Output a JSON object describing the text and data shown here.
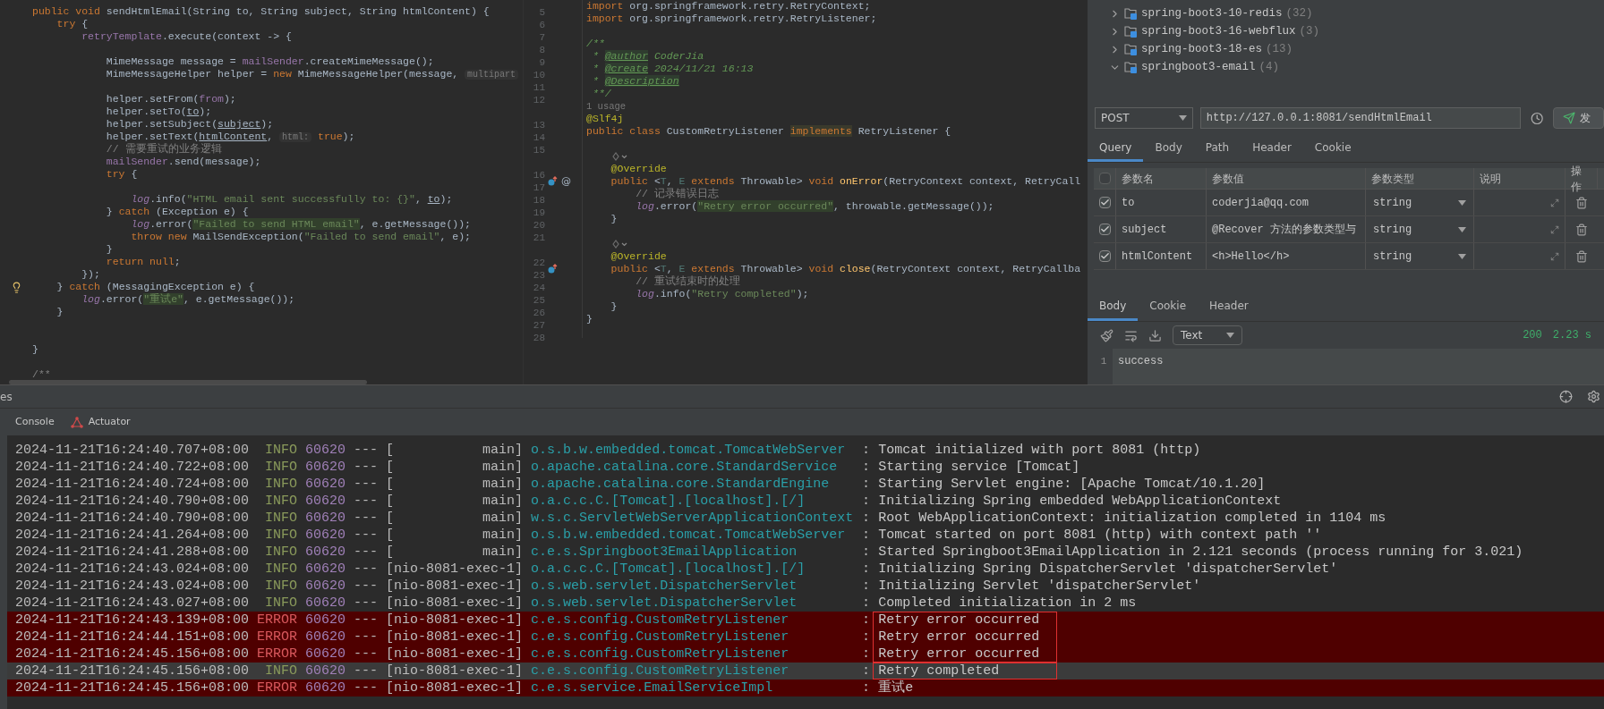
{
  "left_editor": {
    "lines": [
      {
        "kind": "code",
        "segments": [
          {
            "kind": "keyword",
            "text": "public void "
          },
          {
            "kind": "plain",
            "text": "sendHtmlEmail(String to, String subject, String htmlContent) {"
          }
        ]
      },
      {
        "kind": "code",
        "segments": [
          {
            "kind": "keyword",
            "text": "    try"
          },
          {
            "kind": "plain",
            "text": " {"
          }
        ]
      },
      {
        "kind": "code",
        "segments": [
          {
            "kind": "field",
            "text": "        retryTemplate"
          },
          {
            "kind": "plain",
            "text": ".execute(context -> {"
          }
        ]
      },
      {
        "kind": "blank"
      },
      {
        "kind": "code",
        "segments": [
          {
            "kind": "plain",
            "text": "            MimeMessage message = "
          },
          {
            "kind": "field",
            "text": "mailSender"
          },
          {
            "kind": "plain",
            "text": ".createMimeMessage();"
          }
        ]
      },
      {
        "kind": "code",
        "segments": [
          {
            "kind": "plain",
            "text": "            MimeMessageHelper helper = "
          },
          {
            "kind": "keyword",
            "text": "new "
          },
          {
            "kind": "plain",
            "text": "MimeMessageHelper(message, "
          },
          {
            "kind": "hint",
            "text": "multipart"
          }
        ]
      },
      {
        "kind": "blank"
      },
      {
        "kind": "code",
        "segments": [
          {
            "kind": "plain",
            "text": "            helper.setFrom("
          },
          {
            "kind": "field",
            "text": "from"
          },
          {
            "kind": "plain",
            "text": ");"
          }
        ]
      },
      {
        "kind": "code",
        "segments": [
          {
            "kind": "plain",
            "text": "            helper.setTo("
          },
          {
            "kind": "param",
            "text": "to"
          },
          {
            "kind": "plain",
            "text": ");"
          }
        ]
      },
      {
        "kind": "code",
        "segments": [
          {
            "kind": "plain",
            "text": "            helper.setSubject("
          },
          {
            "kind": "param",
            "text": "subject"
          },
          {
            "kind": "plain",
            "text": ");"
          }
        ]
      },
      {
        "kind": "code",
        "segments": [
          {
            "kind": "plain",
            "text": "            helper.setText("
          },
          {
            "kind": "param",
            "text": "htmlContent"
          },
          {
            "kind": "plain",
            "text": ", "
          },
          {
            "kind": "hint",
            "text": "html:"
          },
          {
            "kind": "keyword",
            "text": " true"
          },
          {
            "kind": "plain",
            "text": ");"
          }
        ]
      },
      {
        "kind": "code",
        "segments": [
          {
            "kind": "comment",
            "text": "            // 需要重试的业务逻辑"
          }
        ]
      },
      {
        "kind": "code",
        "segments": [
          {
            "kind": "field",
            "text": "            mailSender"
          },
          {
            "kind": "plain",
            "text": ".send(message);"
          }
        ]
      },
      {
        "kind": "code",
        "segments": [
          {
            "kind": "keyword",
            "text": "            try"
          },
          {
            "kind": "plain",
            "text": " {"
          }
        ]
      },
      {
        "kind": "blank"
      },
      {
        "kind": "code",
        "segments": [
          {
            "kind": "static",
            "text": "                log"
          },
          {
            "kind": "plain",
            "text": ".info("
          },
          {
            "kind": "string",
            "text": "\"HTML email sent successfully to: {}\""
          },
          {
            "kind": "plain",
            "text": ", "
          },
          {
            "kind": "param",
            "text": "to"
          },
          {
            "kind": "plain",
            "text": ");"
          }
        ]
      },
      {
        "kind": "code",
        "segments": [
          {
            "kind": "plain",
            "text": "            } "
          },
          {
            "kind": "keyword",
            "text": "catch"
          },
          {
            "kind": "plain",
            "text": " (Exception e) {"
          }
        ]
      },
      {
        "kind": "code",
        "segments": [
          {
            "kind": "static",
            "text": "                log"
          },
          {
            "kind": "plain",
            "text": ".error("
          },
          {
            "kind": "strhl",
            "text": "\"Failed to send HTML email\""
          },
          {
            "kind": "plain",
            "text": ", e.getMessage());"
          }
        ]
      },
      {
        "kind": "code",
        "segments": [
          {
            "kind": "keyword",
            "text": "                throw new "
          },
          {
            "kind": "plain",
            "text": "MailSendException("
          },
          {
            "kind": "string",
            "text": "\"Failed to send email\""
          },
          {
            "kind": "plain",
            "text": ", e);"
          }
        ]
      },
      {
        "kind": "code",
        "segments": [
          {
            "kind": "plain",
            "text": "            }"
          }
        ]
      },
      {
        "kind": "code",
        "segments": [
          {
            "kind": "keyword",
            "text": "            return null"
          },
          {
            "kind": "plain",
            "text": ";"
          }
        ]
      },
      {
        "kind": "code",
        "segments": [
          {
            "kind": "plain",
            "text": "        });"
          }
        ]
      },
      {
        "kind": "code",
        "bulb": true,
        "segments": [
          {
            "kind": "plain",
            "text": "    } "
          },
          {
            "kind": "keyword",
            "text": "catch"
          },
          {
            "kind": "plain",
            "text": " (MessagingException e) {"
          }
        ]
      },
      {
        "kind": "code",
        "segments": [
          {
            "kind": "static",
            "text": "        log"
          },
          {
            "kind": "plain",
            "text": ".error("
          },
          {
            "kind": "strhl",
            "text": "\"重试e\""
          },
          {
            "kind": "plain",
            "text": ", e.getMessage());"
          }
        ]
      },
      {
        "kind": "code",
        "segments": [
          {
            "kind": "plain",
            "text": "    }"
          }
        ]
      },
      {
        "kind": "blank"
      },
      {
        "kind": "blank"
      },
      {
        "kind": "code",
        "segments": [
          {
            "kind": "plain",
            "text": "}"
          }
        ]
      },
      {
        "kind": "blank"
      },
      {
        "kind": "code",
        "segments": [
          {
            "kind": "comment",
            "text": "/**"
          }
        ]
      }
    ]
  },
  "middle_editor": {
    "lines": [
      {
        "kind": "code",
        "number": "5",
        "segments": [
          {
            "kind": "keyword",
            "text": "import "
          },
          {
            "kind": "plain",
            "text": "org.springframework.retry.RetryContext;"
          }
        ]
      },
      {
        "kind": "code",
        "number": "6",
        "segments": [
          {
            "kind": "keyword",
            "text": "import "
          },
          {
            "kind": "plain",
            "text": "org.springframework.retry.RetryListener;"
          }
        ]
      },
      {
        "kind": "blank",
        "number": "7"
      },
      {
        "kind": "code",
        "number": "8",
        "segments": [
          {
            "kind": "doc",
            "text": "/**"
          }
        ]
      },
      {
        "kind": "code",
        "number": "9",
        "segments": [
          {
            "kind": "doc",
            "text": " * "
          },
          {
            "kind": "doctag",
            "text": "@author"
          },
          {
            "kind": "doc",
            "text": " CoderJia"
          }
        ]
      },
      {
        "kind": "code",
        "number": "10",
        "segments": [
          {
            "kind": "doc",
            "text": " * "
          },
          {
            "kind": "doctag",
            "text": "@create"
          },
          {
            "kind": "doc",
            "text": " 2024/11/21 16:13"
          }
        ]
      },
      {
        "kind": "code",
        "number": "11",
        "segments": [
          {
            "kind": "doc",
            "text": " * "
          },
          {
            "kind": "doctag",
            "text": "@Description"
          }
        ]
      },
      {
        "kind": "code",
        "number": "12",
        "segments": [
          {
            "kind": "doc",
            "text": " **/"
          }
        ]
      },
      {
        "kind": "usage",
        "text": "1 usage"
      },
      {
        "kind": "code",
        "number": "13",
        "segments": [
          {
            "kind": "annotation",
            "text": "@Slf4j"
          }
        ]
      },
      {
        "kind": "code",
        "number": "14",
        "segments": [
          {
            "kind": "keyword",
            "text": "public class "
          },
          {
            "kind": "plain",
            "text": "CustomRetryListener "
          },
          {
            "kind": "kwhl",
            "text": "implements"
          },
          {
            "kind": "plain",
            "text": " RetryListener {"
          }
        ]
      },
      {
        "kind": "blank",
        "number": "15"
      },
      {
        "kind": "lens"
      },
      {
        "kind": "code",
        "number": "16",
        "segments": [
          {
            "kind": "annotation",
            "text": "    @Override"
          }
        ]
      },
      {
        "kind": "code",
        "number": "17",
        "implements": true,
        "gutter_text": "@",
        "segments": [
          {
            "kind": "keyword",
            "text": "    public "
          },
          {
            "kind": "plain",
            "text": "<"
          },
          {
            "kind": "typeparam",
            "text": "T"
          },
          {
            "kind": "plain",
            "text": ", "
          },
          {
            "kind": "typeparam",
            "text": "E "
          },
          {
            "kind": "keyword",
            "text": "extends "
          },
          {
            "kind": "plain",
            "text": "Throwable> "
          },
          {
            "kind": "keyword",
            "text": "void "
          },
          {
            "kind": "method",
            "text": "onError"
          },
          {
            "kind": "plain",
            "text": "(RetryContext context, RetryCall"
          }
        ]
      },
      {
        "kind": "code",
        "number": "18",
        "segments": [
          {
            "kind": "comment",
            "text": "        // 记录错误日志"
          }
        ]
      },
      {
        "kind": "code",
        "number": "19",
        "segments": [
          {
            "kind": "static",
            "text": "        log"
          },
          {
            "kind": "plain",
            "text": ".error("
          },
          {
            "kind": "strhl",
            "text": "\"Retry error occurred\""
          },
          {
            "kind": "plain",
            "text": ", throwable.getMessage());"
          }
        ]
      },
      {
        "kind": "code",
        "number": "20",
        "segments": [
          {
            "kind": "plain",
            "text": "    }"
          }
        ]
      },
      {
        "kind": "blank",
        "number": "21"
      },
      {
        "kind": "lens"
      },
      {
        "kind": "code",
        "number": "22",
        "segments": [
          {
            "kind": "annotation",
            "text": "    @Override"
          }
        ]
      },
      {
        "kind": "code",
        "number": "23",
        "implements": true,
        "segments": [
          {
            "kind": "keyword",
            "text": "    public "
          },
          {
            "kind": "plain",
            "text": "<"
          },
          {
            "kind": "typeparam",
            "text": "T"
          },
          {
            "kind": "plain",
            "text": ", "
          },
          {
            "kind": "typeparam",
            "text": "E "
          },
          {
            "kind": "keyword",
            "text": "extends "
          },
          {
            "kind": "plain",
            "text": "Throwable> "
          },
          {
            "kind": "keyword",
            "text": "void "
          },
          {
            "kind": "method",
            "text": "close"
          },
          {
            "kind": "plain",
            "text": "(RetryContext context, RetryCallba"
          }
        ]
      },
      {
        "kind": "code",
        "number": "24",
        "segments": [
          {
            "kind": "comment",
            "text": "        // 重试结束时的处理"
          }
        ]
      },
      {
        "kind": "code",
        "number": "25",
        "segments": [
          {
            "kind": "static",
            "text": "        log"
          },
          {
            "kind": "plain",
            "text": ".info("
          },
          {
            "kind": "string",
            "text": "\"Retry completed\""
          },
          {
            "kind": "plain",
            "text": ");"
          }
        ]
      },
      {
        "kind": "code",
        "number": "26",
        "segments": [
          {
            "kind": "plain",
            "text": "    }"
          }
        ]
      },
      {
        "kind": "code",
        "number": "27",
        "segments": [
          {
            "kind": "plain",
            "text": "}"
          }
        ]
      },
      {
        "kind": "blank",
        "number": "28"
      }
    ]
  },
  "project_tree": {
    "items": [
      {
        "name": "spring-boot3-10-redis",
        "count": "(32)",
        "expanded": false
      },
      {
        "name": "spring-boot3-16-webflux",
        "count": "(3)",
        "expanded": false
      },
      {
        "name": "spring-boot3-18-es",
        "count": "(13)",
        "expanded": false
      },
      {
        "name": "springboot3-email",
        "count": "(4)",
        "expanded": true
      }
    ]
  },
  "request": {
    "method": "POST",
    "url": "http://127.0.0.1:8081/sendHtmlEmail",
    "send_label": "发",
    "tabs": [
      {
        "label": "Query",
        "selected": true
      },
      {
        "label": "Body",
        "selected": false
      },
      {
        "label": "Path",
        "selected": false
      },
      {
        "label": "Header",
        "selected": false
      },
      {
        "label": "Cookie",
        "selected": false
      }
    ],
    "params": {
      "all_checked": false,
      "columns": [
        "参数名",
        "参数值",
        "参数类型",
        "说明",
        "操作"
      ],
      "rows": [
        {
          "checked": true,
          "name": "to",
          "value": "coderjia@qq.com",
          "type": "string"
        },
        {
          "checked": true,
          "name": "subject",
          "value": "@Recover 方法的参数类型与",
          "type": "string"
        },
        {
          "checked": true,
          "name": "htmlContent",
          "value": "<h>Hello</h>",
          "type": "string"
        }
      ]
    }
  },
  "response": {
    "tabs": [
      {
        "label": "Body",
        "selected": true
      },
      {
        "label": "Cookie",
        "selected": false
      },
      {
        "label": "Header",
        "selected": false
      }
    ],
    "format": "Text",
    "status": "200",
    "time": "2.23 s",
    "line_number": "1",
    "body": "success"
  },
  "tool_window": {
    "title_fragment": "es",
    "tabs": [
      {
        "label": "Console"
      },
      {
        "label": "Actuator"
      }
    ]
  },
  "console": {
    "rows": [
      {
        "kind": "info",
        "timestamp": "2024-11-21T16:24:40.707+08:00",
        "level": "INFO",
        "pid": "60620",
        "dashes": "---",
        "thread": "[           main]",
        "logger": "o.s.b.w.embedded.tomcat.TomcatWebServer",
        "colon": ":",
        "message": "Tomcat initialized with port 8081 (http)"
      },
      {
        "kind": "info",
        "timestamp": "2024-11-21T16:24:40.722+08:00",
        "level": "INFO",
        "pid": "60620",
        "dashes": "---",
        "thread": "[           main]",
        "logger": "o.apache.catalina.core.StandardService",
        "colon": ":",
        "message": "Starting service [Tomcat]"
      },
      {
        "kind": "info",
        "timestamp": "2024-11-21T16:24:40.724+08:00",
        "level": "INFO",
        "pid": "60620",
        "dashes": "---",
        "thread": "[           main]",
        "logger": "o.apache.catalina.core.StandardEngine",
        "colon": ":",
        "message": "Starting Servlet engine: [Apache Tomcat/10.1.20]"
      },
      {
        "kind": "info",
        "timestamp": "2024-11-21T16:24:40.790+08:00",
        "level": "INFO",
        "pid": "60620",
        "dashes": "---",
        "thread": "[           main]",
        "logger": "o.a.c.c.C.[Tomcat].[localhost].[/]",
        "colon": ":",
        "message": "Initializing Spring embedded WebApplicationContext"
      },
      {
        "kind": "info",
        "timestamp": "2024-11-21T16:24:40.790+08:00",
        "level": "INFO",
        "pid": "60620",
        "dashes": "---",
        "thread": "[           main]",
        "logger": "w.s.c.ServletWebServerApplicationContext",
        "colon": ":",
        "message": "Root WebApplicationContext: initialization completed in 1104 ms"
      },
      {
        "kind": "info",
        "timestamp": "2024-11-21T16:24:41.264+08:00",
        "level": "INFO",
        "pid": "60620",
        "dashes": "---",
        "thread": "[           main]",
        "logger": "o.s.b.w.embedded.tomcat.TomcatWebServer",
        "colon": ":",
        "message": "Tomcat started on port 8081 (http) with context path ''"
      },
      {
        "kind": "info",
        "timestamp": "2024-11-21T16:24:41.288+08:00",
        "level": "INFO",
        "pid": "60620",
        "dashes": "---",
        "thread": "[           main]",
        "logger": "c.e.s.Springboot3EmailApplication",
        "colon": ":",
        "message": "Started Springboot3EmailApplication in 2.121 seconds (process running for 3.021)"
      },
      {
        "kind": "info",
        "timestamp": "2024-11-21T16:24:43.024+08:00",
        "level": "INFO",
        "pid": "60620",
        "dashes": "---",
        "thread": "[nio-8081-exec-1]",
        "logger": "o.a.c.c.C.[Tomcat].[localhost].[/]",
        "colon": ":",
        "message": "Initializing Spring DispatcherServlet 'dispatcherServlet'"
      },
      {
        "kind": "info",
        "timestamp": "2024-11-21T16:24:43.024+08:00",
        "level": "INFO",
        "pid": "60620",
        "dashes": "---",
        "thread": "[nio-8081-exec-1]",
        "logger": "o.s.web.servlet.DispatcherServlet",
        "colon": ":",
        "message": "Initializing Servlet 'dispatcherServlet'"
      },
      {
        "kind": "info",
        "timestamp": "2024-11-21T16:24:43.027+08:00",
        "level": "INFO",
        "pid": "60620",
        "dashes": "---",
        "thread": "[nio-8081-exec-1]",
        "logger": "o.s.web.servlet.DispatcherServlet",
        "colon": ":",
        "message": "Completed initialization in 2 ms"
      },
      {
        "kind": "error",
        "boxed": true,
        "timestamp": "2024-11-21T16:24:43.139+08:00",
        "level": "ERROR",
        "pid": "60620",
        "dashes": "---",
        "thread": "[nio-8081-exec-1]",
        "logger": "c.e.s.config.CustomRetryListener",
        "colon": ":",
        "message": "Retry error occurred"
      },
      {
        "kind": "error",
        "boxed": true,
        "timestamp": "2024-11-21T16:24:44.151+08:00",
        "level": "ERROR",
        "pid": "60620",
        "dashes": "---",
        "thread": "[nio-8081-exec-1]",
        "logger": "c.e.s.config.CustomRetryListener",
        "colon": ":",
        "message": "Retry error occurred"
      },
      {
        "kind": "error",
        "boxed": true,
        "timestamp": "2024-11-21T16:24:45.156+08:00",
        "level": "ERROR",
        "pid": "60620",
        "dashes": "---",
        "thread": "[nio-8081-exec-1]",
        "logger": "c.e.s.config.CustomRetryListener",
        "colon": ":",
        "message": "Retry error occurred"
      },
      {
        "kind": "current",
        "boxed": true,
        "timestamp": "2024-11-21T16:24:45.156+08:00",
        "level": "INFO",
        "pid": "60620",
        "dashes": "---",
        "thread": "[nio-8081-exec-1]",
        "logger": "c.e.s.config.CustomRetryListener",
        "colon": ":",
        "message": "Retry completed"
      },
      {
        "kind": "error",
        "timestamp": "2024-11-21T16:24:45.156+08:00",
        "level": "ERROR",
        "pid": "60620",
        "dashes": "---",
        "thread": "[nio-8081-exec-1]",
        "logger": "c.e.s.service.EmailServiceImpl",
        "colon": ":",
        "message": "重试e"
      }
    ]
  }
}
